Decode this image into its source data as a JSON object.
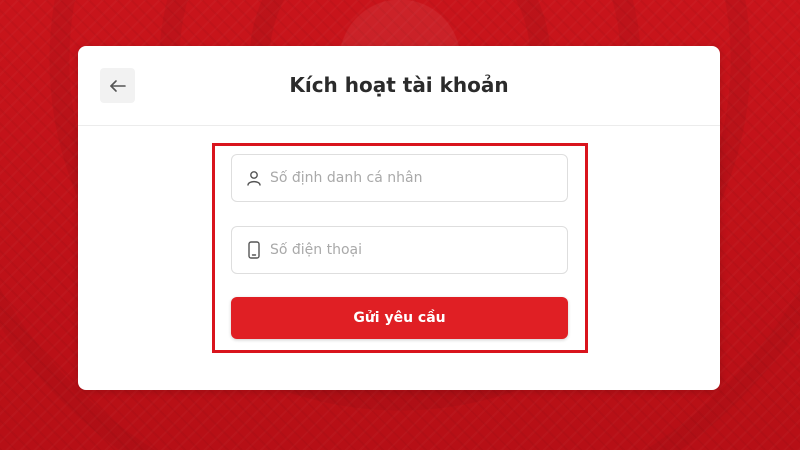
{
  "colors": {
    "background": "#c4121a",
    "accent": "#e01f24",
    "highlight": "#d9141d",
    "card": "#ffffff"
  },
  "header": {
    "back_icon": "arrow-left-icon",
    "title": "Kích hoạt tài khoản"
  },
  "form": {
    "id_field": {
      "icon": "user-icon",
      "value": "",
      "placeholder": "Số định danh cá nhân"
    },
    "phone_field": {
      "icon": "phone-icon",
      "value": "",
      "placeholder": "Số điện thoại"
    },
    "submit_label": "Gửi yêu cầu"
  }
}
